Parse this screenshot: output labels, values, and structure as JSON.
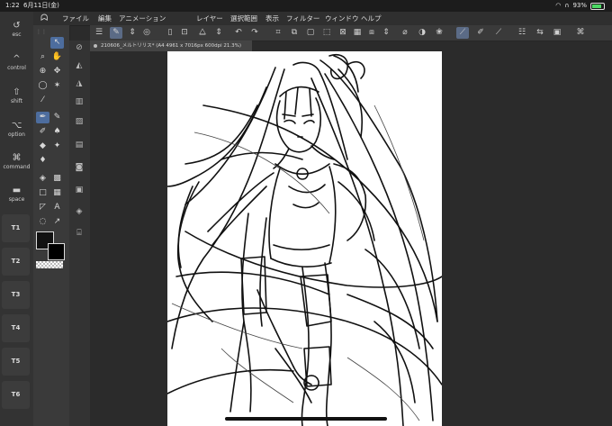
{
  "status_bar": {
    "time": "1:22",
    "date": "6月11日(金)",
    "battery_percent": "93%"
  },
  "menu": {
    "items": [
      "ファイル",
      "編集",
      "アニメーション",
      "レイヤー",
      "選択範囲",
      "表示",
      "フィルター",
      "ウィンドウ",
      "ヘルプ"
    ]
  },
  "edge_keyboard": {
    "keys": [
      {
        "symbol": "↺",
        "label": "esc"
      },
      {
        "symbol": "^",
        "label": "control"
      },
      {
        "symbol": "⇧",
        "label": "shift"
      },
      {
        "symbol": "⌥",
        "label": "option"
      },
      {
        "symbol": "⌘",
        "label": "command"
      },
      {
        "symbol": "▬",
        "label": "space"
      }
    ],
    "t_keys": [
      "T1",
      "T2",
      "T3",
      "T4",
      "T5",
      "T6"
    ]
  },
  "document": {
    "tab_title": "210606_メルトリリス* (A4 4961 x 7016px 600dpi 21.3%)"
  },
  "colors": {
    "accent": "#4d6d9e",
    "main_color": "#111111",
    "sub_color": "#000000",
    "paper": "#ffffff"
  },
  "icons": {
    "tools": [
      "move-icon",
      "zoom-icon",
      "hand-icon",
      "transform-icon",
      "move-layer-icon",
      "lasso-icon",
      "magic-wand-icon",
      "eyedropper-icon",
      "pen-icon",
      "pencil-icon",
      "brush-icon",
      "airbrush-icon",
      "decoration-icon",
      "eraser-icon",
      "blend-icon",
      "fill-icon",
      "gradient-icon",
      "figure-icon",
      "frame-icon",
      "text-icon",
      "ruler-icon",
      "balloon-icon",
      "line-correction-icon",
      "select-icon"
    ]
  }
}
